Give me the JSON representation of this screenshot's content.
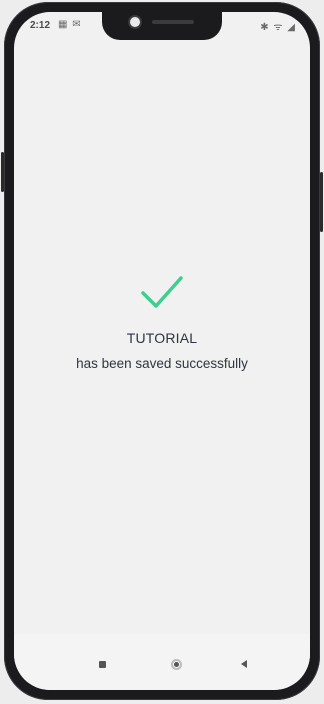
{
  "status_bar": {
    "time": "2:12",
    "notifications": "▦ ✉",
    "right_icons": "✱ ᯤ ◢"
  },
  "confirmation": {
    "icon": "checkmark-icon",
    "title": "TUTORIAL",
    "message": "has been saved successfully",
    "accent_color": "#3ecf8e"
  },
  "nav_bar": {
    "recent_icon": "square-icon",
    "home_icon": "circle-icon",
    "back_icon": "triangle-icon"
  }
}
